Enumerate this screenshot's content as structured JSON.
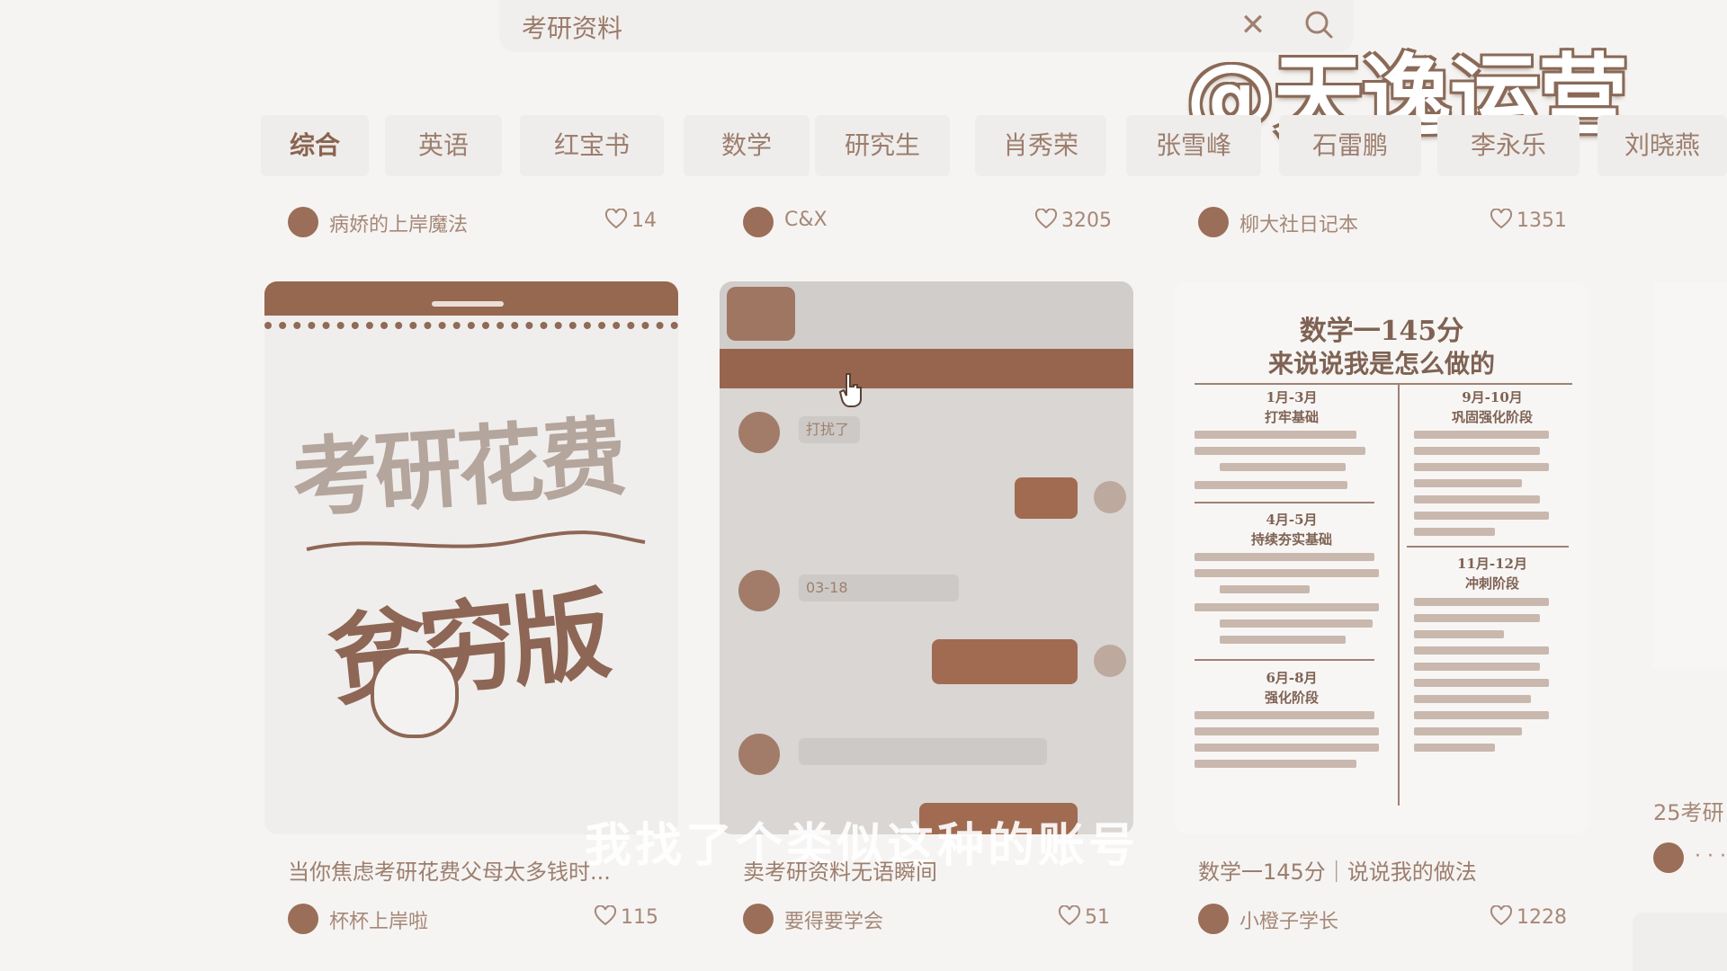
{
  "search": {
    "query": "考研资料",
    "clear_icon": "close-icon",
    "search_icon": "search-icon"
  },
  "watermark": "@天逸运营",
  "tabs": [
    {
      "label": "综合",
      "active": true
    },
    {
      "label": "英语",
      "active": false
    },
    {
      "label": "红宝书",
      "active": false
    },
    {
      "label": "数学",
      "active": false
    },
    {
      "label": "研究生",
      "active": false
    },
    {
      "label": "肖秀荣",
      "active": false
    },
    {
      "label": "张雪峰",
      "active": false
    },
    {
      "label": "石雷鹏",
      "active": false
    },
    {
      "label": "李永乐",
      "active": false
    },
    {
      "label": "刘晓燕",
      "active": false
    }
  ],
  "top_row": [
    {
      "author": "病娇的上岸魔法",
      "likes": "14"
    },
    {
      "author": "C&X",
      "likes": "3205"
    },
    {
      "author": "柳大社日记本",
      "likes": "1351"
    }
  ],
  "cards": [
    {
      "image_text_1": "考研花费",
      "image_text_2": "贫穷版",
      "title": "当你焦虑考研花费父母太多钱时...",
      "author": "杯杯上岸啦",
      "likes": "115"
    },
    {
      "image_text_1": "打扰了",
      "image_text_2": "03-18",
      "title": "卖考研资料无语瞬间",
      "author": "要得要学会",
      "likes": "51"
    },
    {
      "image_text_1": "数学一145分",
      "image_text_2": "来说说我是怎么做的",
      "title": "数学一145分｜说说我的做法",
      "author": "小橙子学长",
      "likes": "1228",
      "sections": [
        "1月-3月",
        "打牢基础",
        "4月-5月",
        "持续夯实基础",
        "6月-8月",
        "强化阶段",
        "9月-10月",
        "巩固强化阶段",
        "11月-12月",
        "冲刺阶段"
      ]
    }
  ],
  "partial_card": {
    "title": "25考研",
    "dots": "· · ·"
  },
  "subtitle": "我找了个类似这种的账号",
  "colors": {
    "accent": "#96684f",
    "background": "#f6f4f2",
    "text": "#9c7e6e"
  }
}
